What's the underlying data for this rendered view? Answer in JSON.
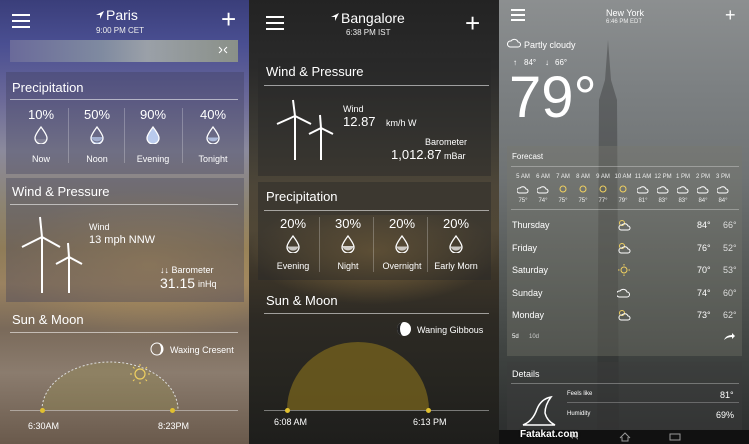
{
  "paris": {
    "city": "Paris",
    "time": "9:00 PM CET",
    "precip_title": "Precipitation",
    "precip": [
      {
        "pct": "10%",
        "label": "Now"
      },
      {
        "pct": "50%",
        "label": "Noon"
      },
      {
        "pct": "90%",
        "label": "Evening"
      },
      {
        "pct": "40%",
        "label": "Tonight"
      }
    ],
    "wind_title": "Wind & Pressure",
    "wind_label": "Wind",
    "wind_value": "13 mph NNW",
    "barometer_label": "↓↓ Barometer",
    "barometer_value": "31.15",
    "barometer_unit": "inHq",
    "sun_title": "Sun & Moon",
    "moon_phase": "Waxing Cresent",
    "sunrise": "6:30AM",
    "sunset": "8:23PM"
  },
  "bangalore": {
    "city": "Bangalore",
    "time": "6:38 PM IST",
    "wind_title": "Wind & Pressure",
    "wind_label": "Wind",
    "wind_value": "12.87",
    "wind_unit": "km/h  W",
    "barometer_label": "Barometer",
    "barometer_value": "1,012.87",
    "barometer_unit": "mBar",
    "precip_title": "Precipitation",
    "precip": [
      {
        "pct": "20%",
        "label": "Evening"
      },
      {
        "pct": "30%",
        "label": "Night"
      },
      {
        "pct": "20%",
        "label": "Overnight"
      },
      {
        "pct": "20%",
        "label": "Early Morn"
      }
    ],
    "sun_title": "Sun & Moon",
    "moon_phase": "Waning Gibbous",
    "sunrise": "6:08 AM",
    "sunset": "6:13 PM"
  },
  "newyork": {
    "city": "New York",
    "time": "6:46 PM EDT",
    "condition": "Partly cloudy",
    "high": "84°",
    "low": "66°",
    "temperature": "79°",
    "forecast_title": "Forecast",
    "hourly": [
      {
        "time": "5 AM",
        "temp": "75°"
      },
      {
        "time": "6 AM",
        "temp": "74°"
      },
      {
        "time": "7 AM",
        "temp": "75°"
      },
      {
        "time": "8 AM",
        "temp": "75°"
      },
      {
        "time": "9 AM",
        "temp": "77°"
      },
      {
        "time": "10 AM",
        "temp": "79°"
      },
      {
        "time": "11 AM",
        "temp": "81°"
      },
      {
        "time": "12 PM",
        "temp": "83°"
      },
      {
        "time": "1 PM",
        "temp": "83°"
      },
      {
        "time": "2 PM",
        "temp": "84°"
      },
      {
        "time": "3 PM",
        "temp": "84°"
      }
    ],
    "daily": [
      {
        "day": "Thursday",
        "high": "84°",
        "low": "66°",
        "icon": "thunder-sun-icon"
      },
      {
        "day": "Friday",
        "high": "76°",
        "low": "52°",
        "icon": "partly-cloudy-icon"
      },
      {
        "day": "Saturday",
        "high": "70°",
        "low": "53°",
        "icon": "sun-icon"
      },
      {
        "day": "Sunday",
        "high": "74°",
        "low": "60°",
        "icon": "cloud-icon"
      },
      {
        "day": "Monday",
        "high": "73°",
        "low": "62°",
        "icon": "partly-cloudy-icon"
      }
    ],
    "toggle_5d": "5d",
    "toggle_10d": "10d",
    "details_title": "Details",
    "feels_like_label": "Feels like",
    "feels_like_value": "81°",
    "humidity_label": "Humidity",
    "humidity_value": "69%"
  },
  "watermark": "Fatakat.com"
}
